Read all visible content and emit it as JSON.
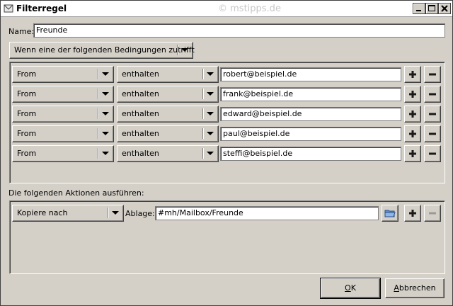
{
  "window": {
    "title": "Filterregel",
    "watermark": "© mstipps.de"
  },
  "name": {
    "label": "Name:",
    "value": "Freunde"
  },
  "match_mode": "Wenn eine der folgenden Bedingungen zutrifft",
  "conditions": [
    {
      "field": "From",
      "operator": "enthalten",
      "value": "robert@beispiel.de"
    },
    {
      "field": "From",
      "operator": "enthalten",
      "value": "frank@beispiel.de"
    },
    {
      "field": "From",
      "operator": "enthalten",
      "value": "edward@beispiel.de"
    },
    {
      "field": "From",
      "operator": "enthalten",
      "value": "paul@beispiel.de"
    },
    {
      "field": "From",
      "operator": "enthalten",
      "value": "steffi@beispiel.de"
    }
  ],
  "actions_label": "Die folgenden Aktionen ausführen:",
  "action": {
    "type": "Kopiere nach",
    "target_label": "Ablage:",
    "target_value": "#mh/Mailbox/Freunde"
  },
  "buttons": {
    "ok_u": "O",
    "ok_rest": "K",
    "cancel_u": "A",
    "cancel_rest": "bbrechen"
  },
  "icons": {
    "add": "plus-icon",
    "remove": "minus-icon",
    "folder": "folder-icon"
  }
}
